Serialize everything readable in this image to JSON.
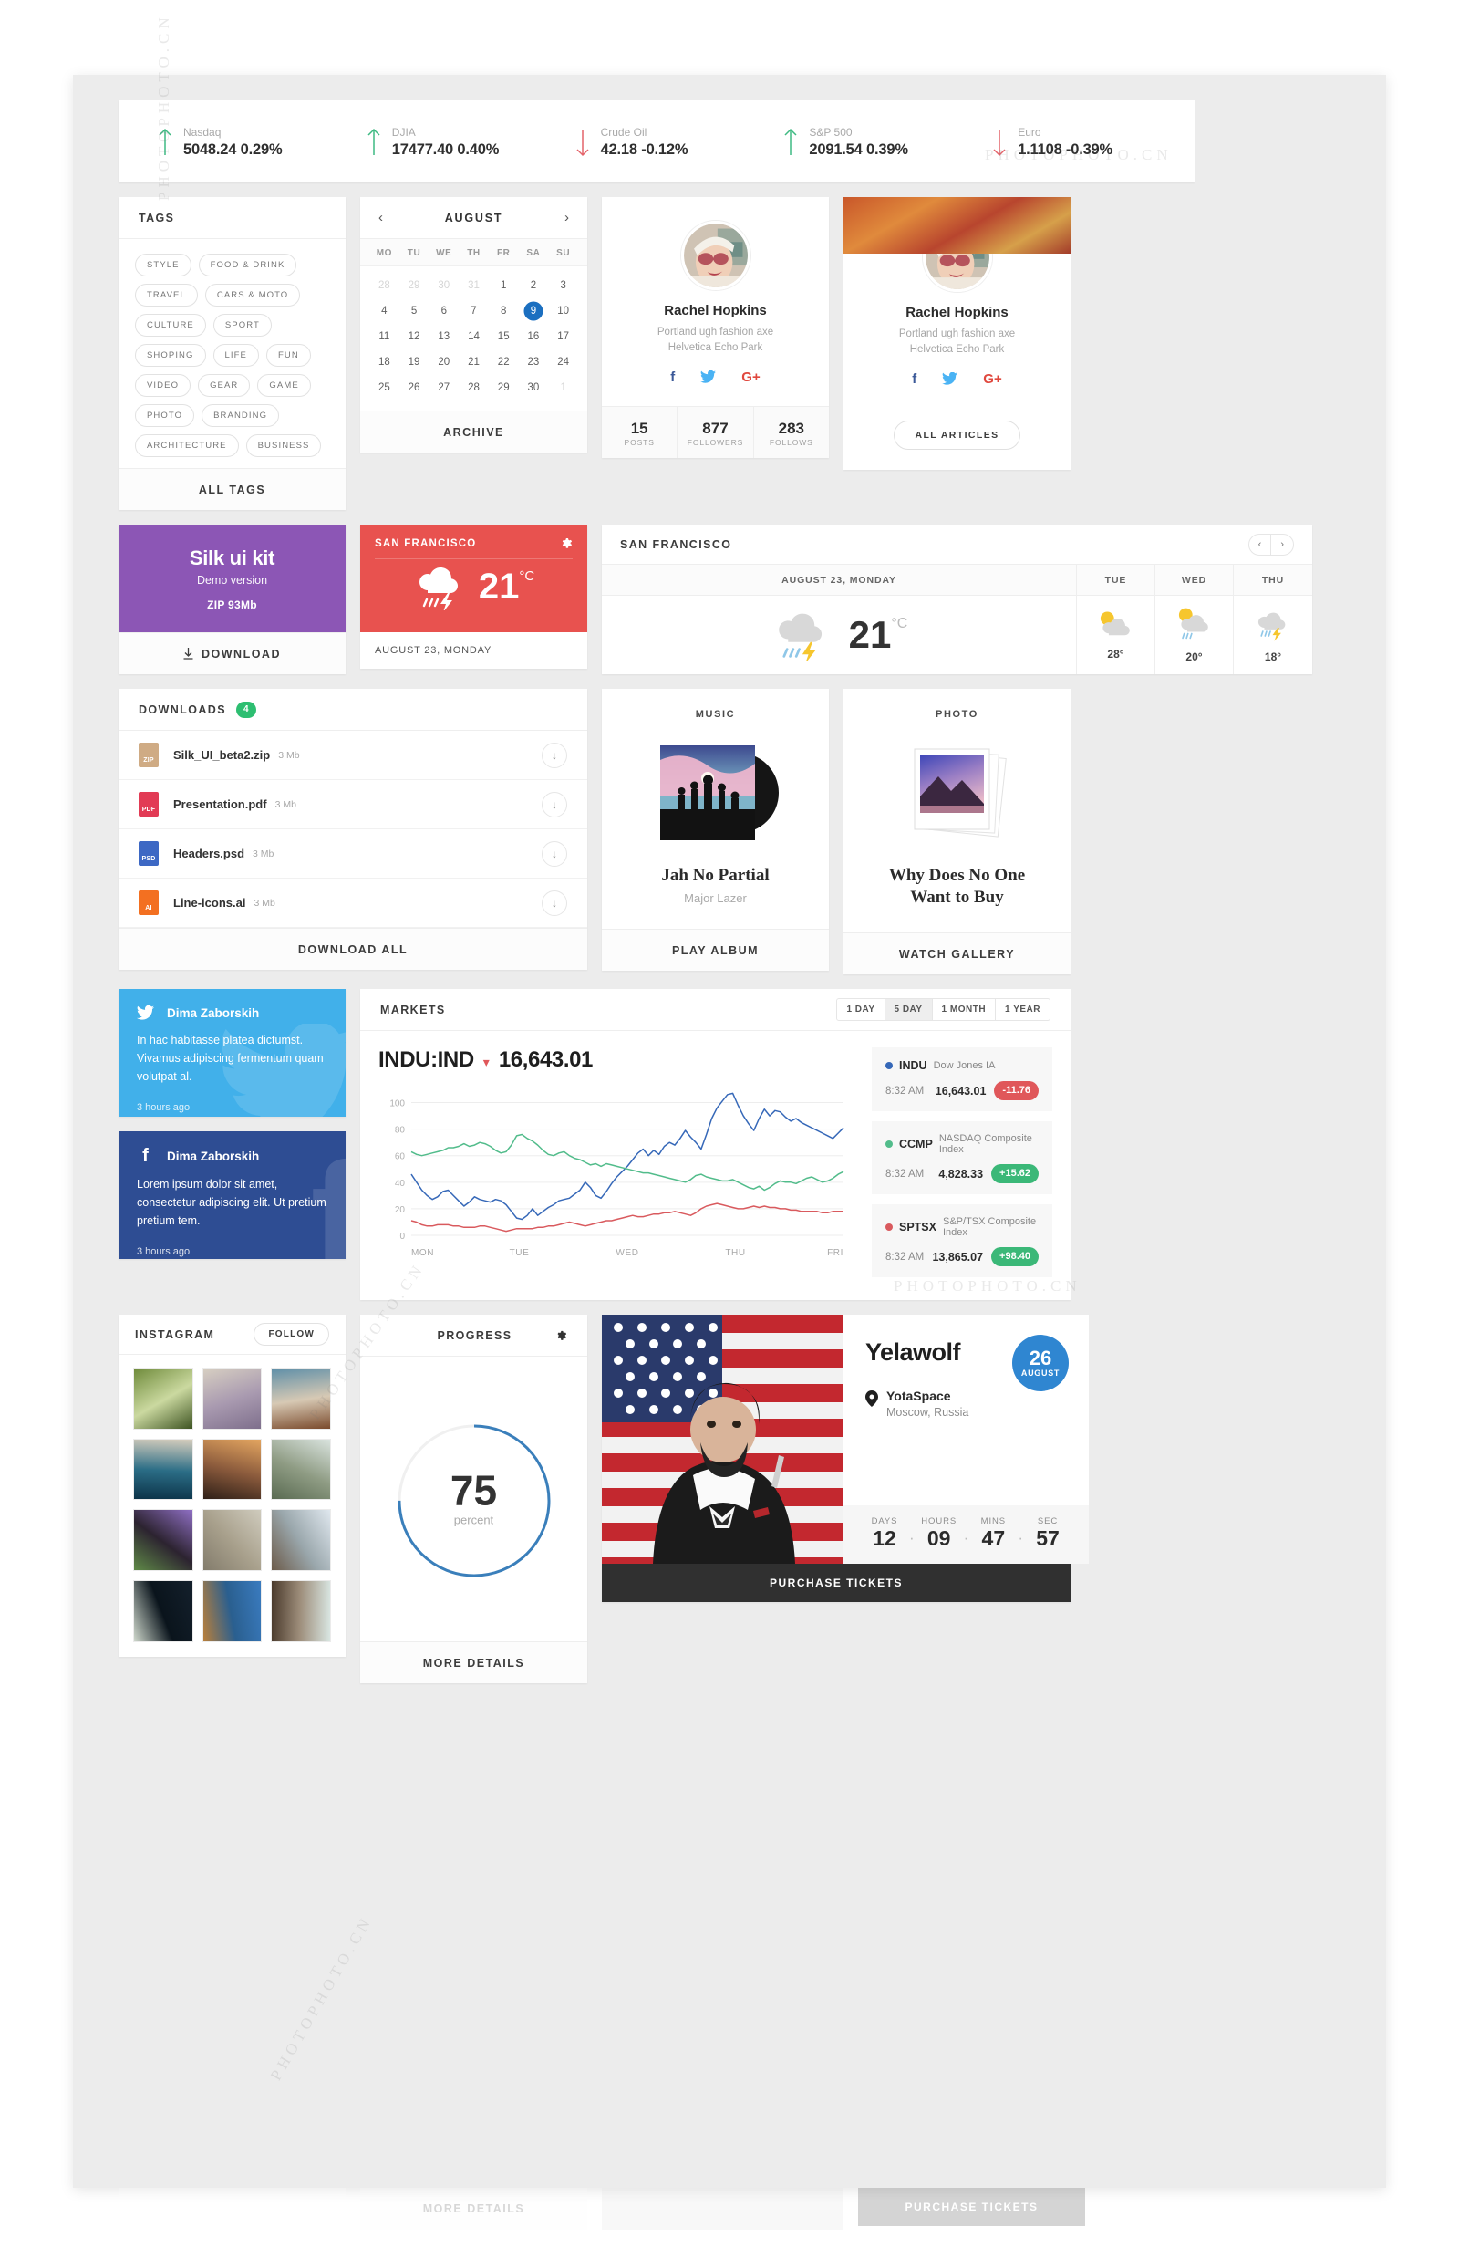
{
  "ticker": {
    "items": [
      {
        "name": "Nasdaq",
        "value": "5048.24 0.29%",
        "dir": "up",
        "icon": "arrow-up-icon"
      },
      {
        "name": "DJIA",
        "value": "17477.40 0.40%",
        "dir": "up",
        "icon": "arrow-up-icon"
      },
      {
        "name": "Crude Oil",
        "value": "42.18 -0.12%",
        "dir": "down",
        "icon": "arrow-down-icon"
      },
      {
        "name": "S&P 500",
        "value": "2091.54 0.39%",
        "dir": "up",
        "icon": "arrow-up-icon"
      },
      {
        "name": "Euro",
        "value": "1.1108 -0.39%",
        "dir": "down",
        "icon": "arrow-down-icon"
      }
    ],
    "up_color": "#3fba83",
    "down_color": "#e4636a"
  },
  "tags": {
    "title": "TAGS",
    "items": [
      "STYLE",
      "FOOD & DRINK",
      "TRAVEL",
      "CARS & MOTO",
      "CULTURE",
      "SPORT",
      "SHOPING",
      "LIFE",
      "FUN",
      "VIDEO",
      "GEAR",
      "GAME",
      "PHOTO",
      "BRANDING",
      "ARCHITECTURE",
      "BUSINESS"
    ],
    "footer": "ALL TAGS"
  },
  "calendar": {
    "month": "AUGUST",
    "prev": "‹",
    "next": "›",
    "dows": [
      "MO",
      "TU",
      "WE",
      "TH",
      "FR",
      "SA",
      "SU"
    ],
    "days": [
      {
        "d": "28",
        "mute": true
      },
      {
        "d": "29",
        "mute": true
      },
      {
        "d": "30",
        "mute": true
      },
      {
        "d": "31",
        "mute": true
      },
      {
        "d": "1"
      },
      {
        "d": "2"
      },
      {
        "d": "3"
      },
      {
        "d": "4"
      },
      {
        "d": "5"
      },
      {
        "d": "6"
      },
      {
        "d": "7"
      },
      {
        "d": "8"
      },
      {
        "d": "9",
        "selected": true
      },
      {
        "d": "10"
      },
      {
        "d": "11"
      },
      {
        "d": "12"
      },
      {
        "d": "13"
      },
      {
        "d": "14"
      },
      {
        "d": "15"
      },
      {
        "d": "16"
      },
      {
        "d": "17"
      },
      {
        "d": "18"
      },
      {
        "d": "19"
      },
      {
        "d": "20"
      },
      {
        "d": "21"
      },
      {
        "d": "22"
      },
      {
        "d": "23"
      },
      {
        "d": "24"
      },
      {
        "d": "25"
      },
      {
        "d": "26"
      },
      {
        "d": "27"
      },
      {
        "d": "28"
      },
      {
        "d": "29"
      },
      {
        "d": "30"
      },
      {
        "d": "1",
        "mute": true
      }
    ],
    "selected_color": "#1b6fc0",
    "footer": "ARCHIVE"
  },
  "profile_stats": {
    "name": "Rachel Hopkins",
    "bio_line1": "Portland ugh fashion axe",
    "bio_line2": "Helvetica Echo Park",
    "social": [
      {
        "icon": "facebook-icon",
        "glyph": "f",
        "color": "#3b5998"
      },
      {
        "icon": "twitter-icon",
        "glyph": "ᵗ",
        "color": "#4ab3f4"
      },
      {
        "icon": "google-plus-icon",
        "glyph": "G+",
        "color": "#e0483e"
      }
    ],
    "stats": [
      {
        "number": "15",
        "label": "POSTS"
      },
      {
        "number": "877",
        "label": "FOLLOWERS"
      },
      {
        "number": "283",
        "label": "FOLLOWS"
      }
    ]
  },
  "profile_articles": {
    "name": "Rachel Hopkins",
    "bio_line1": "Portland ugh fashion axe",
    "bio_line2": "Helvetica Echo Park",
    "button": "ALL ARTICLES"
  },
  "silk_kit": {
    "title": "Silk ui kit",
    "subtitle": "Demo version",
    "size": "ZIP 93Mb",
    "footer": "DOWNLOAD",
    "download_icon": "download-arrow-icon",
    "bg_color": "#8c56b5"
  },
  "weather_small": {
    "city": "SAN FRANCISCO",
    "gear_icon": "gear-icon",
    "temp": "21",
    "unit": "°C",
    "icon": "thunderstorm-icon",
    "date": "AUGUST 23, MONDAY",
    "bg_color": "#e8524f"
  },
  "weather_big": {
    "city": "SAN FRANCISCO",
    "prev": "‹",
    "next": "›",
    "today_label": "AUGUST 23, MONDAY",
    "today_temp": "21",
    "today_unit": "°C",
    "today_icon": "thunderstorm-icon",
    "days": [
      {
        "label": "TUE",
        "temp": "28°",
        "icon": "sun-cloud-icon"
      },
      {
        "label": "WED",
        "temp": "20°",
        "icon": "sun-cloud-rain-icon"
      },
      {
        "label": "THU",
        "temp": "18°",
        "icon": "thunderstorm-icon"
      }
    ]
  },
  "downloads": {
    "title": "DOWNLOADS",
    "count": "4",
    "badge_color": "#2dbe71",
    "items": [
      {
        "name": "Silk_UI_beta2.zip",
        "size": "3 Mb",
        "ext": "ZIP",
        "color": "#cfab84"
      },
      {
        "name": "Presentation.pdf",
        "size": "3 Mb",
        "ext": "PDF",
        "color": "#e23b55"
      },
      {
        "name": "Headers.psd",
        "size": "3 Mb",
        "ext": "PSD",
        "color": "#3d68c4"
      },
      {
        "name": "Line-icons.ai",
        "size": "3 Mb",
        "ext": "AI",
        "color": "#f37021"
      }
    ],
    "footer": "DOWNLOAD ALL",
    "row_icon": "download-arrow-icon"
  },
  "music": {
    "kicker": "MUSIC",
    "title": "Jah No Partial",
    "artist": "Major Lazer",
    "footer": "PLAY ALBUM",
    "art_icon": "vinyl-album-icon"
  },
  "photo": {
    "kicker": "PHOTO",
    "title_line1": "Why Does No One",
    "title_line2": "Want to Buy",
    "footer": "WATCH GALLERY",
    "art_icon": "polaroid-stack-icon"
  },
  "twitter_card": {
    "icon": "twitter-icon",
    "author": "Dima Zaborskih",
    "text": "In hac habitasse platea dictumst. Vivamus adipiscing fermentum quam volutpat al.",
    "time": "3 hours ago",
    "bg_color": "#41b0ea"
  },
  "facebook_card": {
    "icon": "facebook-icon",
    "author": "Dima Zaborskih",
    "text": "Lorem ipsum dolor sit amet, consectetur adipiscing elit. Ut pretium pretium tem.",
    "time": "3 hours ago",
    "bg_color": "#2e4d93"
  },
  "markets": {
    "title": "MARKETS",
    "ranges": [
      {
        "label": "1 DAY",
        "active": false
      },
      {
        "label": "5 DAY",
        "active": true
      },
      {
        "label": "1 MONTH",
        "active": false
      },
      {
        "label": "1 YEAR",
        "active": false
      }
    ],
    "symbol": "INDU:IND",
    "value": "16,643.01",
    "caret": "▾",
    "quotes": [
      {
        "symbol": "INDU",
        "name": "Dow Jones IA",
        "time": "8:32 AM",
        "price": "16,643.01",
        "change": "-11.76",
        "dir": "down",
        "color": "#3668b8"
      },
      {
        "symbol": "CCMP",
        "name": "NASDAQ Composite Index",
        "time": "8:32 AM",
        "price": "4,828.33",
        "change": "+15.62",
        "dir": "up",
        "color": "#52bc8b"
      },
      {
        "symbol": "SPTSX",
        "name": "S&P/TSX Composite Index",
        "time": "8:32 AM",
        "price": "13,865.07",
        "change": "+98.40",
        "dir": "up",
        "color": "#d95a5e"
      }
    ]
  },
  "chart_data": {
    "type": "line",
    "title": "INDU:IND",
    "xlabel": "",
    "ylabel": "",
    "ylim": [
      0,
      110
    ],
    "yticks": [
      0,
      20,
      40,
      60,
      80,
      100
    ],
    "xticks": [
      "MON",
      "TUE",
      "WED",
      "THU",
      "FRI"
    ],
    "grid": true,
    "legend": "none",
    "series": [
      {
        "name": "INDU",
        "color": "#3668b8",
        "values": [
          46,
          40,
          34,
          30,
          27,
          29,
          33,
          34,
          30,
          26,
          22,
          25,
          29,
          27,
          26,
          25,
          27,
          26,
          23,
          18,
          13,
          12,
          15,
          20,
          15,
          18,
          21,
          23,
          26,
          27,
          28,
          31,
          34,
          40,
          36,
          30,
          28,
          33,
          39,
          44,
          48,
          52,
          57,
          62,
          65,
          60,
          64,
          61,
          67,
          70,
          68,
          73,
          79,
          74,
          70,
          65,
          76,
          88,
          96,
          101,
          106,
          107,
          98,
          90,
          84,
          79,
          88,
          95,
          90,
          94,
          93,
          89,
          86,
          88,
          85,
          83,
          81,
          79,
          77,
          75,
          73,
          77,
          81
        ]
      },
      {
        "name": "CCMP",
        "color": "#52bc8b",
        "values": [
          63,
          61,
          60,
          61,
          62,
          63,
          64,
          66,
          66,
          67,
          69,
          67,
          68,
          70,
          69,
          67,
          64,
          62,
          63,
          68,
          75,
          76,
          73,
          71,
          68,
          64,
          61,
          60,
          62,
          63,
          60,
          58,
          57,
          55,
          53,
          54,
          52,
          54,
          53,
          52,
          51,
          50,
          49,
          48,
          47,
          47,
          46,
          45,
          44,
          43,
          42,
          41,
          40,
          42,
          45,
          46,
          44,
          43,
          42,
          41,
          41,
          42,
          40,
          38,
          36,
          35,
          37,
          34,
          36,
          39,
          41,
          40,
          40,
          39,
          41,
          43,
          44,
          42,
          40,
          41,
          43,
          46,
          48
        ]
      },
      {
        "name": "SPTSX",
        "color": "#d95a5e",
        "values": [
          11,
          10,
          8,
          7,
          7,
          8,
          8,
          8,
          7,
          7,
          6,
          6,
          6,
          7,
          7,
          6,
          5,
          4,
          3,
          4,
          5,
          5,
          5,
          5,
          6,
          6,
          7,
          7,
          8,
          9,
          10,
          9,
          8,
          7,
          8,
          9,
          10,
          11,
          11,
          12,
          13,
          14,
          15,
          14,
          14,
          15,
          16,
          16,
          17,
          17,
          18,
          17,
          16,
          15,
          17,
          20,
          22,
          23,
          24,
          23,
          22,
          21,
          20,
          20,
          21,
          22,
          21,
          22,
          21,
          21,
          20,
          20,
          19,
          19,
          18,
          18,
          18,
          18,
          17,
          17,
          18,
          18,
          18
        ]
      }
    ]
  },
  "instagram": {
    "title": "INSTAGRAM",
    "follow": "FOLLOW",
    "thumbs": [
      {
        "name": "greenhouse",
        "c1": "#6e8a3a",
        "c2": "#cbd9a0",
        "c3": "#3e5422"
      },
      {
        "name": "beach-dusk",
        "c1": "#d7cfc2",
        "c2": "#a99ab0",
        "c3": "#7e6f8c"
      },
      {
        "name": "desk-setup",
        "c1": "#5f8fa8",
        "c2": "#d7c9b4",
        "c3": "#7a4a2c"
      },
      {
        "name": "coastline",
        "c1": "#d6cdbd",
        "c2": "#2b6d86",
        "c3": "#0c3348"
      },
      {
        "name": "sunset-rocks",
        "c1": "#e3a560",
        "c2": "#8a5a3c",
        "c3": "#2f2018"
      },
      {
        "name": "hills-haze",
        "c1": "#d9e3de",
        "c2": "#8f9c84",
        "c3": "#5a6b52"
      },
      {
        "name": "purple-flowers",
        "c1": "#8f6fc4",
        "c2": "#2c2330",
        "c3": "#5f8a47"
      },
      {
        "name": "stone-wall",
        "c1": "#cfcbbd",
        "c2": "#a8a08c",
        "c3": "#837c6c"
      },
      {
        "name": "lake-figure",
        "c1": "#dfe7ee",
        "c2": "#9aa7ac",
        "c3": "#6c5b4a"
      },
      {
        "name": "night-lights",
        "c1": "#14202c",
        "c2": "#0a141c",
        "c3": "#cfd8cc"
      },
      {
        "name": "blue-field",
        "c1": "#3a7bbf",
        "c2": "#2a5f8f",
        "c3": "#b97f3a"
      },
      {
        "name": "coffee-cup",
        "c1": "#d9e6e2",
        "c2": "#9d8d7a",
        "c3": "#4a3a2c"
      }
    ]
  },
  "progress": {
    "title": "PROGRESS",
    "gear_icon": "gear-icon",
    "value": "75",
    "unit": "percent",
    "percent": 75,
    "track_color": "#f0f0f0",
    "bar_color": "#3a7fbb",
    "footer": "MORE DETAILS"
  },
  "event": {
    "name": "Yelawolf",
    "day": "26",
    "month": "AUGUST",
    "badge_color": "#2f86d1",
    "pin_icon": "location-pin-icon",
    "venue": "YotaSpace",
    "city": "Moscow, Russia",
    "countdown": [
      {
        "label": "DAYS",
        "value": "12"
      },
      {
        "label": "HOURS",
        "value": "09"
      },
      {
        "label": "MINS",
        "value": "47"
      },
      {
        "label": "SEC",
        "value": "57"
      }
    ],
    "separator": "·",
    "cta": "PURCHASE TICKETS"
  }
}
